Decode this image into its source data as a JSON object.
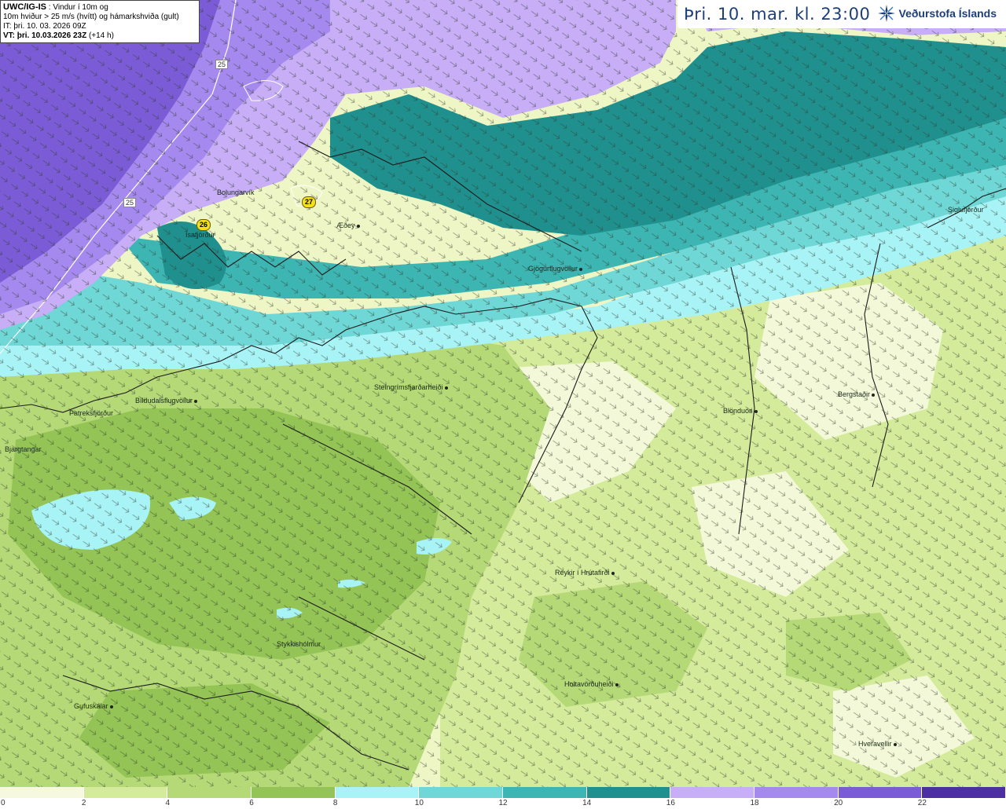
{
  "info": {
    "model": "UWC/IG-IS",
    "line1_rest": " : Vindur í 10m og",
    "line2": "10m hviður > 25 m/s (hvítt) og hámarkshviða (gult)",
    "line3": "IT: þri. 10. 03. 2026 09Z",
    "line4_bold": "VT: þri. 10.03.2026 23Z",
    "line4_rest": " (+14 h)"
  },
  "header": {
    "valid_time": "Þri. 10. mar. kl. 23:00",
    "logo_text": "Veðurstofa Íslands",
    "logo_icon": "weather-office-star-icon"
  },
  "places": [
    {
      "name": "Bolungarvík",
      "dot": false
    },
    {
      "name": "Ísafjörður",
      "dot": false
    },
    {
      "name": "Æðey",
      "dot": true
    },
    {
      "name": "Gjögurflugvöllur",
      "dot": true
    },
    {
      "name": "Siglufjörður",
      "dot": false
    },
    {
      "name": "Steingrímsfjarðarheiði",
      "dot": true
    },
    {
      "name": "Bíldudalsflugvöllur",
      "dot": true
    },
    {
      "name": "Patreksfjörður",
      "dot": false
    },
    {
      "name": "Bjargtangar",
      "dot": false
    },
    {
      "name": "Blönduós",
      "dot": true
    },
    {
      "name": "Bergstaðir",
      "dot": true
    },
    {
      "name": "Reykir í Hrútafirði",
      "dot": true
    },
    {
      "name": "Stykkishólmur",
      "dot": false
    },
    {
      "name": "Holtavörðuheiði",
      "dot": true
    },
    {
      "name": "Gufuskálar",
      "dot": true
    },
    {
      "name": "Hveravellir",
      "dot": true
    }
  ],
  "max_gusts": [
    {
      "value": "27"
    },
    {
      "value": "26"
    }
  ],
  "contour_labels": [
    {
      "value": "25"
    },
    {
      "value": "25"
    }
  ],
  "legend": {
    "unit": "m/s",
    "ticks": [
      "0",
      "2",
      "4",
      "6",
      "8",
      "10",
      "12",
      "14",
      "16",
      "18",
      "20",
      "22"
    ],
    "colors": [
      "#f6f9df",
      "#d5eb9c",
      "#b5d977",
      "#93c455",
      "#a8f3f6",
      "#6fd7d5",
      "#3db5b2",
      "#20908e",
      "#c7aef6",
      "#a589ee",
      "#7b5cd6",
      "#4c2fa3"
    ]
  }
}
